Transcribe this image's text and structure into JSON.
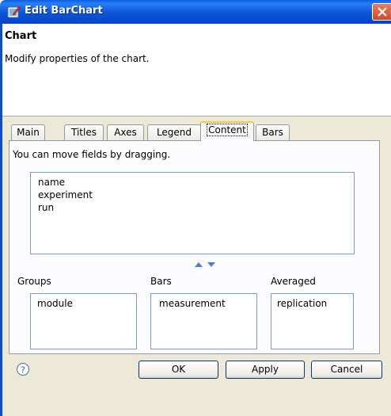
{
  "window": {
    "title": "Edit BarChart"
  },
  "header": {
    "title": "Chart",
    "description": "Modify properties of the chart."
  },
  "tabs": [
    {
      "label": "Main",
      "active": false
    },
    {
      "label": "Titles",
      "active": false
    },
    {
      "label": "Axes",
      "active": false
    },
    {
      "label": "Legend",
      "active": false
    },
    {
      "label": "Content",
      "active": true
    },
    {
      "label": "Bars",
      "active": false
    }
  ],
  "content": {
    "hint": "You can move fields by dragging.",
    "fields": [
      "name",
      "experiment",
      "run"
    ],
    "groups": {
      "label": "Groups",
      "items": [
        "module"
      ]
    },
    "bars": {
      "label": "Bars",
      "items": [
        "measurement"
      ]
    },
    "averaged": {
      "label": "Averaged",
      "items": [
        "replication"
      ]
    }
  },
  "buttons": {
    "ok": "OK",
    "apply": "Apply",
    "cancel": "Cancel"
  },
  "colors": {
    "titlebar": "#0b55d8",
    "active_tab_highlight": "#ffc83c",
    "list_border": "#7f9db9",
    "dialog_background": "#ece9d8"
  }
}
